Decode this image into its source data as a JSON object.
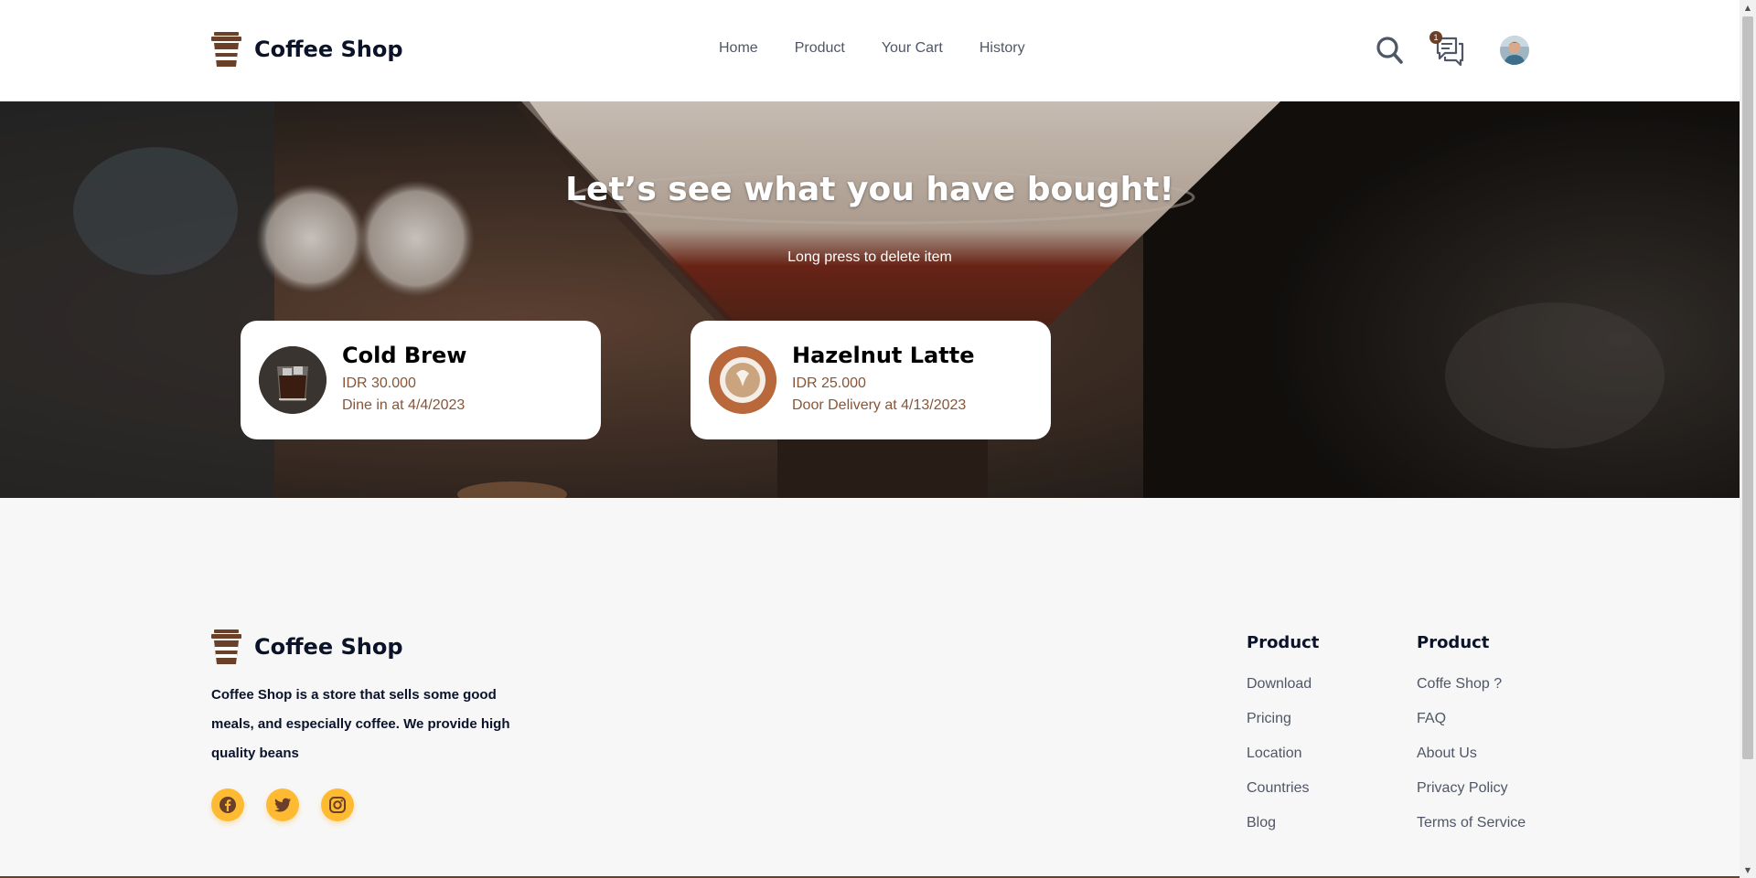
{
  "brand": {
    "name": "Coffee Shop"
  },
  "nav": {
    "items": [
      "Home",
      "Product",
      "Your Cart",
      "History"
    ]
  },
  "header": {
    "notification_count": "1"
  },
  "hero": {
    "title": "Let’s see what you have bought!",
    "subtitle": "Long press to delete item"
  },
  "history": [
    {
      "name": "Cold Brew",
      "price": "IDR 30.000",
      "detail": "Dine in at 4/4/2023"
    },
    {
      "name": "Hazelnut Latte",
      "price": "IDR 25.000",
      "detail": "Door Delivery at 4/13/2023"
    }
  ],
  "footer": {
    "brand": "Coffee Shop",
    "description": "Coffee Shop is a store that sells some good meals, and especially coffee. We provide high quality beans",
    "socials": [
      "facebook-icon",
      "twitter-icon",
      "instagram-icon"
    ],
    "col1": {
      "title": "Product",
      "links": [
        "Download",
        "Pricing",
        "Location",
        "Countries",
        "Blog"
      ]
    },
    "col2": {
      "title": "Product",
      "links": [
        "Coffe Shop ?",
        "FAQ",
        "About Us",
        "Privacy Policy",
        "Terms of Service"
      ]
    }
  },
  "colors": {
    "brown": "#6a4029",
    "accent": "#ffba33",
    "text_dark": "#0b132a",
    "text_muted": "#4f5665",
    "price": "#895537"
  }
}
